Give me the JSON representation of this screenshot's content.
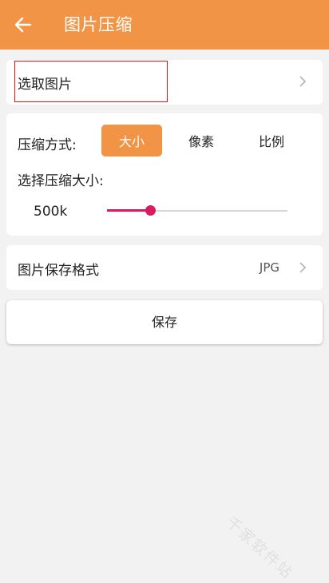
{
  "header": {
    "title": "图片压缩",
    "back_icon": "arrow-left-icon"
  },
  "pick_image": {
    "label": "选取图片",
    "chevron_icon": "chevron-right-icon"
  },
  "compression": {
    "mode_label": "压缩方式:",
    "modes": [
      {
        "label": "大小",
        "active": true
      },
      {
        "label": "像素",
        "active": false
      },
      {
        "label": "比例",
        "active": false
      }
    ],
    "size_label": "选择压缩大小:",
    "value_text": "500k",
    "slider_fraction": 0.24
  },
  "format": {
    "label": "图片保存格式",
    "value": "JPG",
    "chevron_icon": "chevron-right-icon"
  },
  "save": {
    "label": "保存"
  },
  "watermark": {
    "text": "千家软件站"
  },
  "colors": {
    "accent": "#f29446",
    "slider": "#d81b60",
    "highlight": "#e11111"
  }
}
